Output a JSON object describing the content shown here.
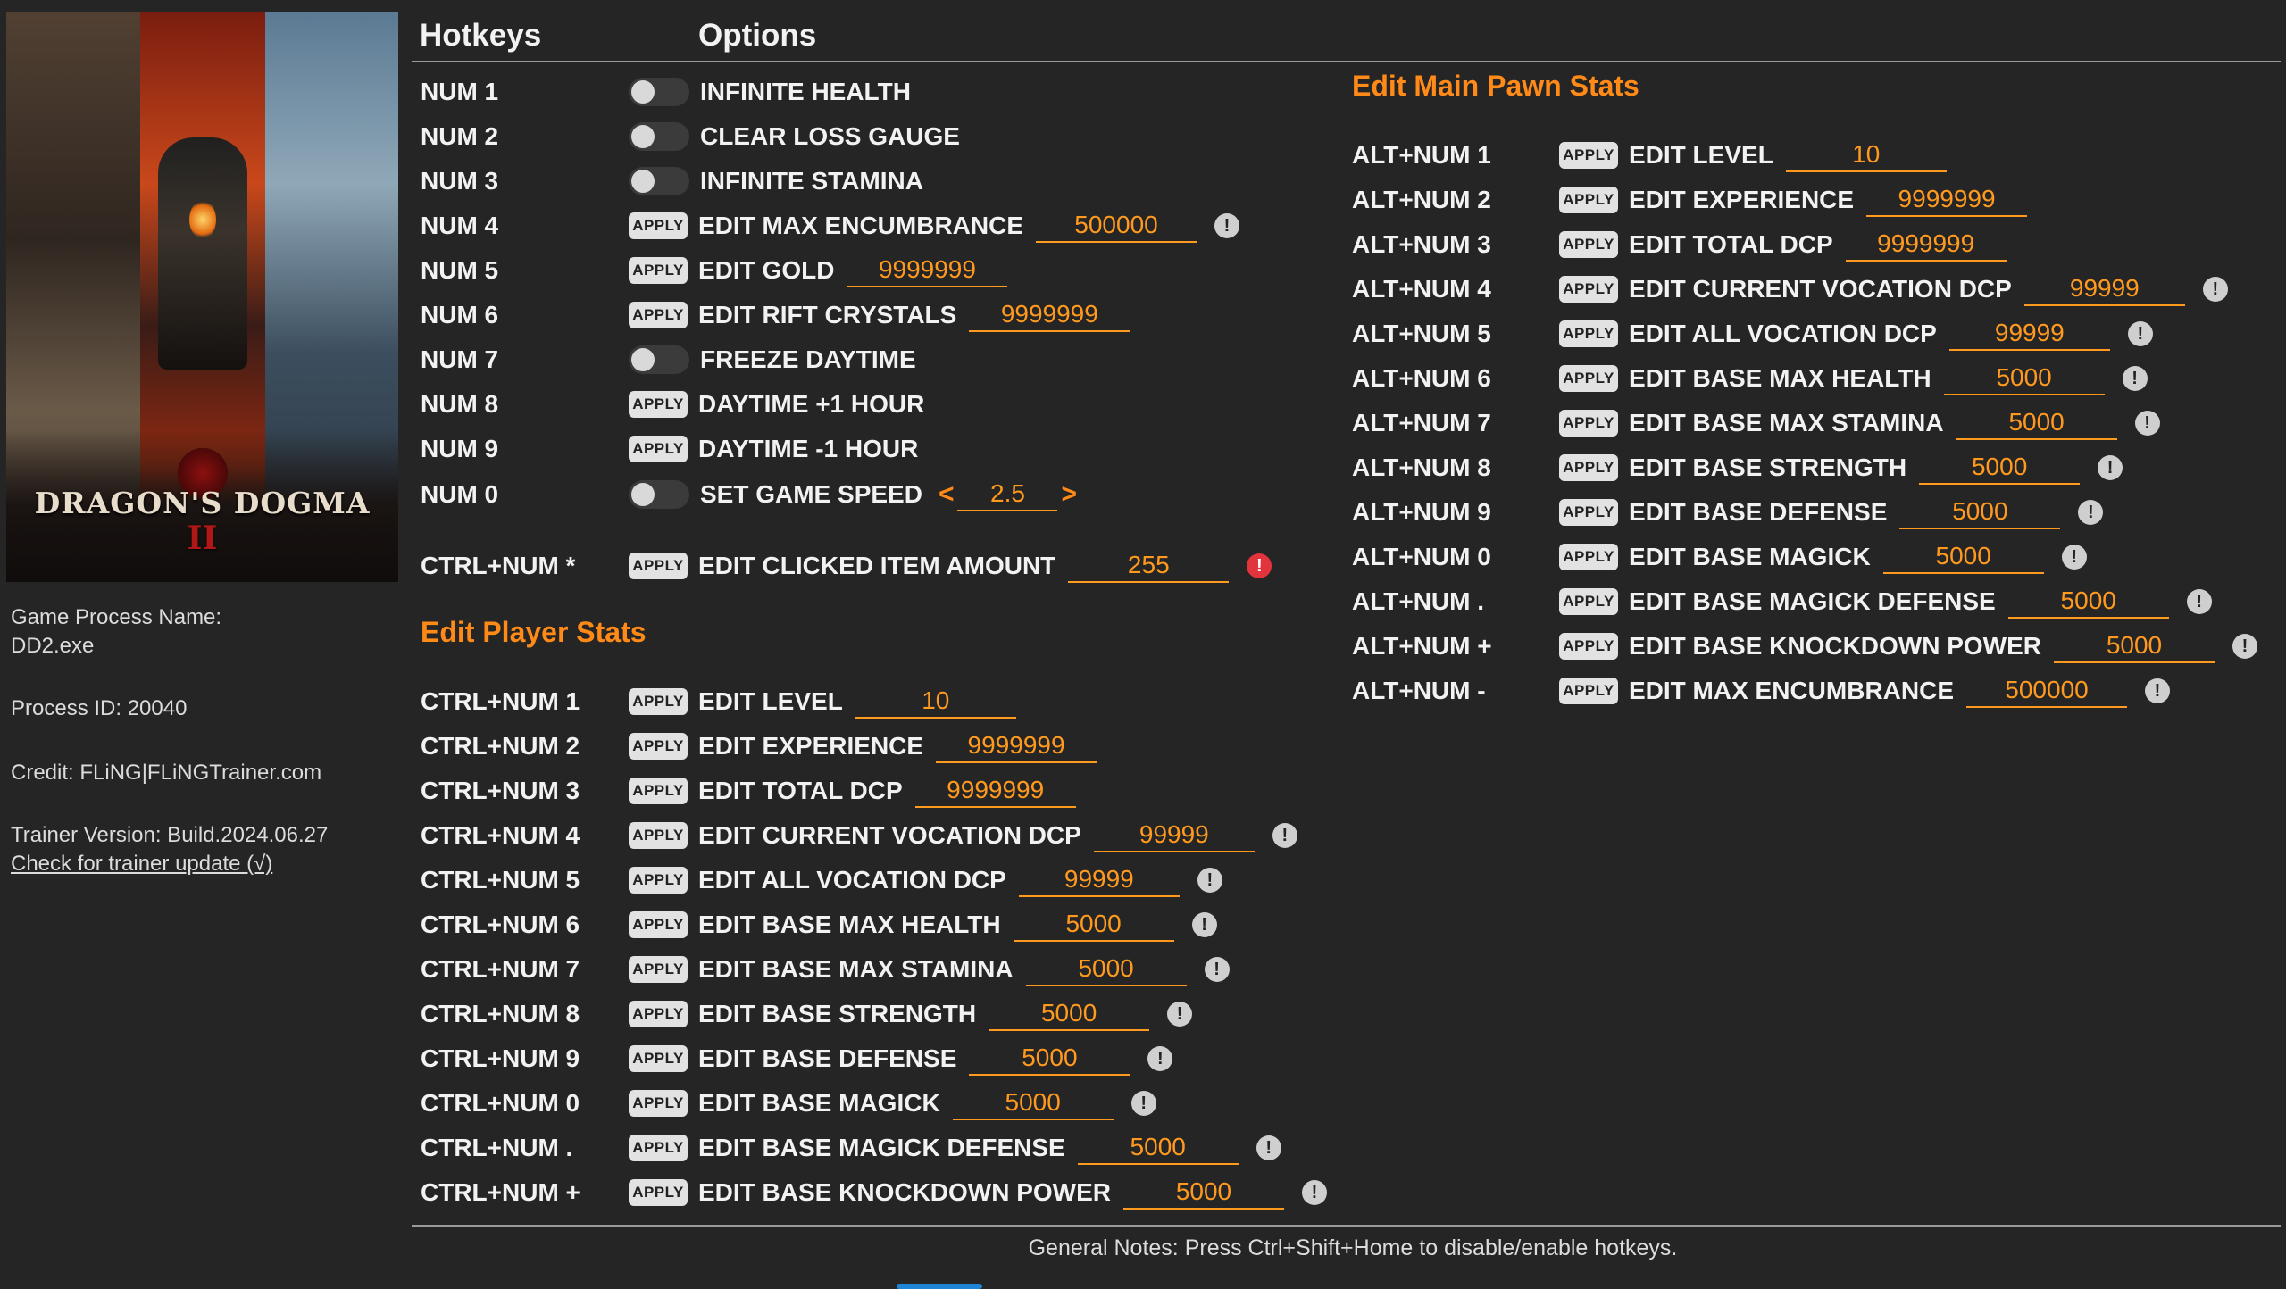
{
  "cover": {
    "logo_line1": "DRAGON'S DOGMA",
    "logo_line2": "II"
  },
  "info": {
    "process_name_label": "Game Process Name:",
    "process_name": "DD2.exe",
    "process_id": "Process ID: 20040",
    "credit": "Credit: FLiNG|FLiNGTrainer.com",
    "version": "Trainer Version: Build.2024.06.27",
    "update_link": "Check for trainer update (√)"
  },
  "header": {
    "hotkeys": "Hotkeys",
    "options": "Options"
  },
  "apply_label": "APPLY",
  "main_rows": [
    {
      "key": "NUM 1",
      "type": "toggle",
      "label": "INFINITE HEALTH"
    },
    {
      "key": "NUM 2",
      "type": "toggle",
      "label": "CLEAR LOSS GAUGE"
    },
    {
      "key": "NUM 3",
      "type": "toggle",
      "label": "INFINITE STAMINA"
    },
    {
      "key": "NUM 4",
      "type": "apply",
      "label": "EDIT MAX ENCUMBRANCE",
      "value": "500000",
      "warn": true
    },
    {
      "key": "NUM 5",
      "type": "apply",
      "label": "EDIT GOLD",
      "value": "9999999"
    },
    {
      "key": "NUM 6",
      "type": "apply",
      "label": "EDIT RIFT CRYSTALS",
      "value": "9999999"
    },
    {
      "key": "NUM 7",
      "type": "toggle",
      "label": "FREEZE DAYTIME"
    },
    {
      "key": "NUM 8",
      "type": "apply",
      "label": "DAYTIME +1 HOUR"
    },
    {
      "key": "NUM 9",
      "type": "apply",
      "label": "DAYTIME -1 HOUR"
    },
    {
      "key": "NUM 0",
      "type": "speed",
      "label": "SET GAME SPEED",
      "value": "2.5",
      "left": "<",
      "right": ">"
    },
    {
      "key": "CTRL+NUM *",
      "type": "apply",
      "label": "EDIT CLICKED ITEM AMOUNT",
      "value": "255",
      "warn": true,
      "warn_red": true
    }
  ],
  "player_section": {
    "title": "Edit Player Stats",
    "rows": [
      {
        "key": "CTRL+NUM 1",
        "label": "EDIT LEVEL",
        "value": "10"
      },
      {
        "key": "CTRL+NUM 2",
        "label": "EDIT EXPERIENCE",
        "value": "9999999"
      },
      {
        "key": "CTRL+NUM 3",
        "label": "EDIT TOTAL DCP",
        "value": "9999999"
      },
      {
        "key": "CTRL+NUM 4",
        "label": "EDIT CURRENT VOCATION DCP",
        "value": "99999",
        "warn": true
      },
      {
        "key": "CTRL+NUM 5",
        "label": "EDIT ALL VOCATION DCP",
        "value": "99999",
        "warn": true
      },
      {
        "key": "CTRL+NUM 6",
        "label": "EDIT BASE MAX HEALTH",
        "value": "5000",
        "warn": true
      },
      {
        "key": "CTRL+NUM 7",
        "label": "EDIT BASE MAX STAMINA",
        "value": "5000",
        "warn": true
      },
      {
        "key": "CTRL+NUM 8",
        "label": "EDIT BASE STRENGTH",
        "value": "5000",
        "warn": true
      },
      {
        "key": "CTRL+NUM 9",
        "label": "EDIT BASE DEFENSE",
        "value": "5000",
        "warn": true
      },
      {
        "key": "CTRL+NUM 0",
        "label": "EDIT BASE MAGICK",
        "value": "5000",
        "warn": true
      },
      {
        "key": "CTRL+NUM .",
        "label": "EDIT BASE MAGICK DEFENSE",
        "value": "5000",
        "warn": true
      },
      {
        "key": "CTRL+NUM +",
        "label": "EDIT BASE KNOCKDOWN POWER",
        "value": "5000",
        "warn": true
      }
    ]
  },
  "pawn_section": {
    "title": "Edit Main Pawn Stats",
    "rows": [
      {
        "key": "ALT+NUM 1",
        "label": "EDIT LEVEL",
        "value": "10"
      },
      {
        "key": "ALT+NUM 2",
        "label": "EDIT EXPERIENCE",
        "value": "9999999"
      },
      {
        "key": "ALT+NUM 3",
        "label": "EDIT TOTAL DCP",
        "value": "9999999"
      },
      {
        "key": "ALT+NUM 4",
        "label": "EDIT CURRENT VOCATION DCP",
        "value": "99999",
        "warn": true
      },
      {
        "key": "ALT+NUM 5",
        "label": "EDIT ALL VOCATION DCP",
        "value": "99999",
        "warn": true
      },
      {
        "key": "ALT+NUM 6",
        "label": "EDIT BASE MAX HEALTH",
        "value": "5000",
        "warn": true
      },
      {
        "key": "ALT+NUM 7",
        "label": "EDIT BASE MAX STAMINA",
        "value": "5000",
        "warn": true
      },
      {
        "key": "ALT+NUM 8",
        "label": "EDIT BASE STRENGTH",
        "value": "5000",
        "warn": true
      },
      {
        "key": "ALT+NUM 9",
        "label": "EDIT BASE DEFENSE",
        "value": "5000",
        "warn": true
      },
      {
        "key": "ALT+NUM 0",
        "label": "EDIT BASE MAGICK",
        "value": "5000",
        "warn": true
      },
      {
        "key": "ALT+NUM .",
        "label": "EDIT BASE MAGICK DEFENSE",
        "value": "5000",
        "warn": true
      },
      {
        "key": "ALT+NUM +",
        "label": "EDIT BASE KNOCKDOWN POWER",
        "value": "5000",
        "warn": true
      },
      {
        "key": "ALT+NUM -",
        "label": "EDIT MAX ENCUMBRANCE",
        "value": "500000",
        "warn": true
      }
    ]
  },
  "warn_glyph": "!",
  "footer": {
    "notes": "General Notes: Press Ctrl+Shift+Home to disable/enable hotkeys."
  },
  "colors": {
    "accent": "#ff8a17",
    "background": "#252525",
    "warn_red": "#e2343c"
  }
}
